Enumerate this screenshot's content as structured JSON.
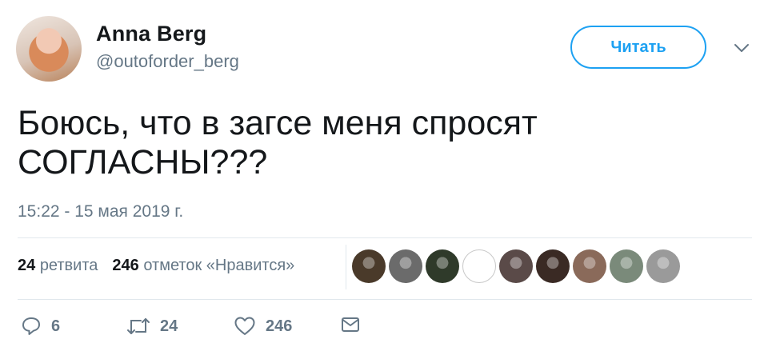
{
  "tweet": {
    "author_name": "Anna Berg",
    "author_handle": "@outoforder_berg",
    "follow_label": "Читать",
    "text": "Боюсь, что в загсе меня спросят\nСОГЛАСНЫ???",
    "timestamp": "15:22 - 15 мая 2019 г."
  },
  "stats": {
    "retweets_count": "24",
    "retweets_label": "ретвита",
    "likes_count": "246",
    "likes_label": "отметок «Нравится»"
  },
  "likers": [
    {
      "icon": "liker-avatar",
      "color": "#4a3a2a"
    },
    {
      "icon": "liker-avatar",
      "color": "#6b6b6b"
    },
    {
      "icon": "liker-avatar",
      "color": "#2f3a2a"
    },
    {
      "icon": "liker-avatar",
      "color": "#ffffff"
    },
    {
      "icon": "liker-avatar",
      "color": "#5a4a48"
    },
    {
      "icon": "liker-avatar",
      "color": "#3a2a24"
    },
    {
      "icon": "liker-avatar",
      "color": "#8a6a5a"
    },
    {
      "icon": "liker-avatar",
      "color": "#7a8a7a"
    },
    {
      "icon": "liker-avatar",
      "color": "#9a9a9a"
    }
  ],
  "actions": {
    "reply_count": "6",
    "retweet_count": "24",
    "like_count": "246"
  },
  "colors": {
    "accent": "#1da1f2",
    "secondary_text": "#657786",
    "divider": "#e1e8ed"
  }
}
